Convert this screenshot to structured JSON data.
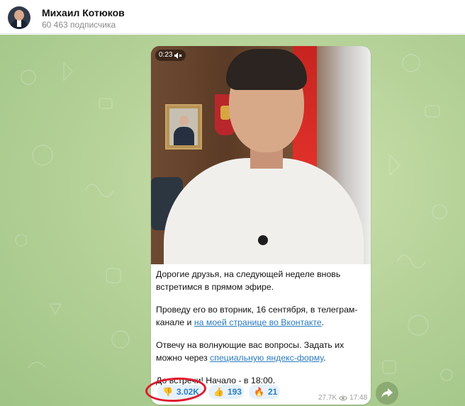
{
  "channel": {
    "name": "Михаил Котюков",
    "subscribers": "60 463 подписчика"
  },
  "video": {
    "duration": "0:23",
    "muted_icon": "muted-speaker-icon"
  },
  "post": {
    "p1": "Дорогие друзья, на следующей неделе вновь встретимся в прямом эфире.",
    "p2_text": "Проведу его во вторник, 16 сентября, в телеграм-канале и ",
    "p2_link": "на моей странице во Вконтакте",
    "p2_end": ".",
    "p3_text": "Отвечу на волнующие вас вопросы. Задать их можно через ",
    "p3_link": "специальную яндекс-форму",
    "p3_end": ".",
    "p4": "До встречи! Начало - в 18:00."
  },
  "reactions": [
    {
      "emoji": "👎",
      "icon": "thumbs-down-icon",
      "count": "3.02K"
    },
    {
      "emoji": "👍",
      "icon": "thumbs-up-icon",
      "count": "193"
    },
    {
      "emoji": "🔥",
      "icon": "fire-icon",
      "count": "21"
    }
  ],
  "meta": {
    "views": "27.7K",
    "time": "17:48"
  },
  "colors": {
    "accent": "#2b80c2",
    "highlight_circle": "#e0172d",
    "chat_background": "#b7d39a"
  }
}
